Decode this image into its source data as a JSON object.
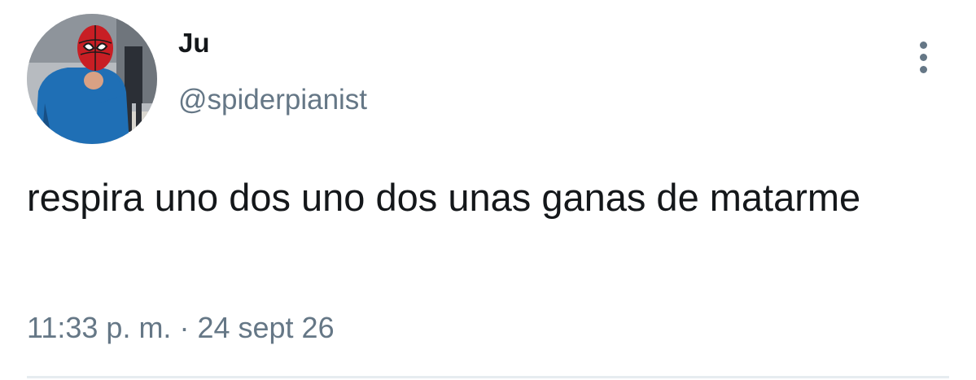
{
  "user": {
    "display_name": "Ju",
    "handle": "@spiderpianist",
    "avatar_icon": "avatar-photo"
  },
  "tweet": {
    "text": "respira uno dos uno dos unas ganas de matarme",
    "time": "11:33 p. m.",
    "separator": "·",
    "date": "24 sept 26"
  },
  "menu": {
    "icon": "more-vertical-icon"
  },
  "colors": {
    "text": "#14171a",
    "secondary": "#657786",
    "divider": "#e6ecf0"
  }
}
